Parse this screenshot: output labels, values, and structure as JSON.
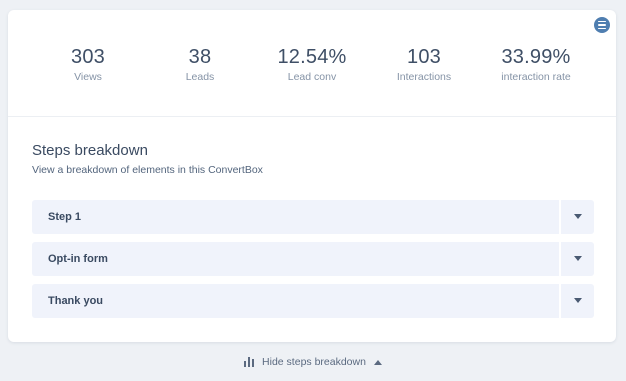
{
  "stats": [
    {
      "value": "303",
      "label": "Views"
    },
    {
      "value": "38",
      "label": "Leads"
    },
    {
      "value": "12.54%",
      "label": "Lead conv"
    },
    {
      "value": "103",
      "label": "Interactions"
    },
    {
      "value": "33.99%",
      "label": "interaction rate"
    }
  ],
  "breakdown": {
    "title": "Steps breakdown",
    "subtitle": "View a breakdown of elements in this ConvertBox",
    "steps": [
      {
        "label": "Step 1"
      },
      {
        "label": "Opt-in form"
      },
      {
        "label": "Thank you"
      }
    ]
  },
  "footer": {
    "toggle_label": "Hide steps breakdown"
  },
  "colors": {
    "accent": "#4f7eb0",
    "background": "#eef1f5",
    "row_background": "#f0f3fb"
  }
}
